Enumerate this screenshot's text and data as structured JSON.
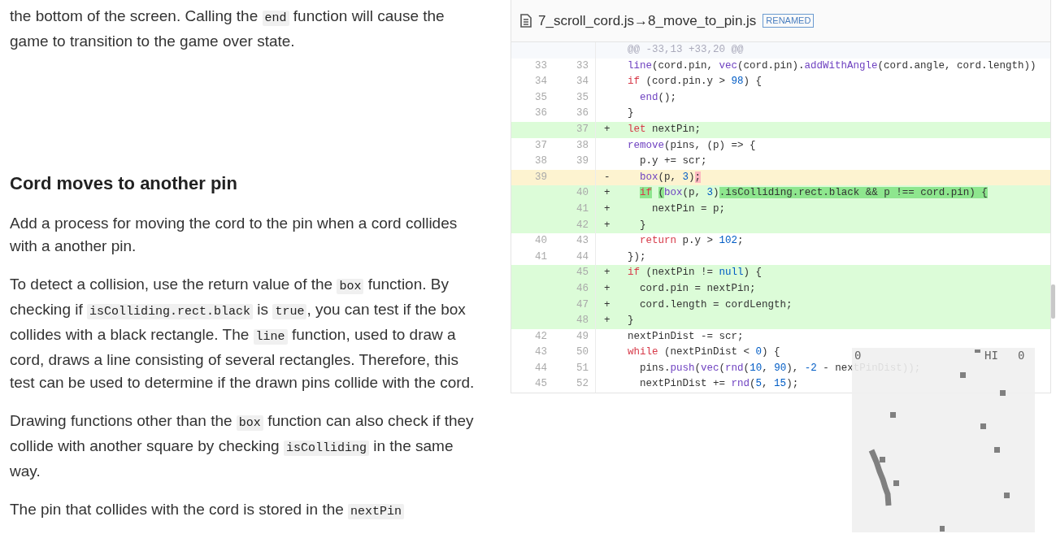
{
  "article": [
    {
      "kind": "paragraph",
      "parts": [
        {
          "kind": "text",
          "text": "the bottom of the screen. Calling the "
        },
        {
          "kind": "code",
          "text": "end"
        },
        {
          "kind": "text",
          "text": " function will cause the game to transition to the game over state."
        }
      ]
    },
    {
      "kind": "heading",
      "parts": [
        {
          "kind": "text",
          "text": "Cord moves to another pin"
        }
      ]
    },
    {
      "kind": "paragraph",
      "parts": [
        {
          "kind": "text",
          "text": "Add a process for moving the cord to the pin when a cord collides with a another pin."
        }
      ]
    },
    {
      "kind": "paragraph",
      "parts": [
        {
          "kind": "text",
          "text": "To detect a collision, use the return value of the "
        },
        {
          "kind": "code",
          "text": "box"
        },
        {
          "kind": "text",
          "text": " function. By checking if "
        },
        {
          "kind": "code",
          "text": "isColliding.rect.black"
        },
        {
          "kind": "text",
          "text": " is "
        },
        {
          "kind": "code",
          "text": "true"
        },
        {
          "kind": "text",
          "text": ", you can test if the box collides with a black rectangle. The "
        },
        {
          "kind": "code",
          "text": "line"
        },
        {
          "kind": "text",
          "text": " function, used to draw a cord, draws a line consisting of several rectangles. Therefore, this test can be used to determine if the drawn pins collide with the cord."
        }
      ]
    },
    {
      "kind": "paragraph",
      "parts": [
        {
          "kind": "text",
          "text": "Drawing functions other than the "
        },
        {
          "kind": "code",
          "text": "box"
        },
        {
          "kind": "text",
          "text": " function can also check if they collide with another square by checking "
        },
        {
          "kind": "code",
          "text": "isColliding"
        },
        {
          "kind": "text",
          "text": " in the same way."
        }
      ]
    },
    {
      "kind": "paragraph",
      "parts": [
        {
          "kind": "text",
          "text": "The pin that collides with the cord is stored in the "
        },
        {
          "kind": "code",
          "text": "nextPin"
        }
      ]
    }
  ],
  "diff": {
    "old_file": "7_scroll_cord.js",
    "arrow": "→",
    "new_file": "8_move_to_pin.js",
    "badge": "RENAMED",
    "lines": [
      {
        "kind": "hunk",
        "code": [
          {
            "t": "@@ -33,13 +33,20 @@",
            "kind": "plain"
          }
        ]
      },
      {
        "kind": "context",
        "old": "33",
        "new": "33",
        "code": [
          {
            "t": "line",
            "kind": "fn"
          },
          {
            "t": "(cord.pin, ",
            "kind": "plain"
          },
          {
            "t": "vec",
            "kind": "fn"
          },
          {
            "t": "(cord.pin).",
            "kind": "plain"
          },
          {
            "t": "addWithAngle",
            "kind": "fn"
          },
          {
            "t": "(cord.angle, cord.length))",
            "kind": "plain"
          }
        ]
      },
      {
        "kind": "context",
        "old": "34",
        "new": "34",
        "code": [
          {
            "t": "if",
            "kind": "kw"
          },
          {
            "t": " (cord.pin.y > ",
            "kind": "plain"
          },
          {
            "t": "98",
            "kind": "num"
          },
          {
            "t": ") {",
            "kind": "plain"
          }
        ]
      },
      {
        "kind": "context",
        "old": "35",
        "new": "35",
        "code": [
          {
            "t": "  end",
            "kind": "fn"
          },
          {
            "t": "();",
            "kind": "plain"
          }
        ]
      },
      {
        "kind": "context",
        "old": "36",
        "new": "36",
        "code": [
          {
            "t": "}",
            "kind": "plain"
          }
        ]
      },
      {
        "kind": "add",
        "new": "37",
        "sign": "+",
        "code": [
          {
            "t": "let",
            "kind": "kw"
          },
          {
            "t": " nextPin;",
            "kind": "plain"
          }
        ]
      },
      {
        "kind": "context",
        "old": "37",
        "new": "38",
        "code": [
          {
            "t": "remove",
            "kind": "fn"
          },
          {
            "t": "(pins, (p) => {",
            "kind": "plain"
          }
        ]
      },
      {
        "kind": "context",
        "old": "38",
        "new": "39",
        "code": [
          {
            "t": "  p.y += scr;",
            "kind": "plain"
          }
        ]
      },
      {
        "kind": "del",
        "old": "39",
        "sign": "-",
        "code": [
          {
            "t": "  box",
            "kind": "fn",
            "changed": false
          },
          {
            "t": "(p, ",
            "kind": "plain",
            "changed": false
          },
          {
            "t": "3",
            "kind": "num",
            "changed": false
          },
          {
            "t": ")",
            "kind": "plain",
            "changed": false
          },
          {
            "t": ";",
            "kind": "plain",
            "changed": true
          }
        ]
      },
      {
        "kind": "add",
        "new": "40",
        "sign": "+",
        "code": [
          {
            "t": "  if",
            "kind": "kw",
            "changed": true
          },
          {
            "t": " (",
            "kind": "plain",
            "changed": true
          },
          {
            "t": "box",
            "kind": "fn",
            "changed": false
          },
          {
            "t": "(p, ",
            "kind": "plain",
            "changed": false
          },
          {
            "t": "3",
            "kind": "num",
            "changed": false
          },
          {
            "t": ")",
            "kind": "plain",
            "changed": false
          },
          {
            "t": ".isColliding.rect.black && p !== cord.pin) {",
            "kind": "plain",
            "changed": true
          }
        ]
      },
      {
        "kind": "add",
        "new": "41",
        "sign": "+",
        "code": [
          {
            "t": "    nextPin = p;",
            "kind": "plain"
          }
        ]
      },
      {
        "kind": "add",
        "new": "42",
        "sign": "+",
        "code": [
          {
            "t": "  }",
            "kind": "plain"
          }
        ]
      },
      {
        "kind": "context",
        "old": "40",
        "new": "43",
        "code": [
          {
            "t": "  return",
            "kind": "kw"
          },
          {
            "t": " p.y > ",
            "kind": "plain"
          },
          {
            "t": "102",
            "kind": "num"
          },
          {
            "t": ";",
            "kind": "plain"
          }
        ]
      },
      {
        "kind": "context",
        "old": "41",
        "new": "44",
        "code": [
          {
            "t": "});",
            "kind": "plain"
          }
        ]
      },
      {
        "kind": "add",
        "new": "45",
        "sign": "+",
        "code": [
          {
            "t": "if",
            "kind": "kw"
          },
          {
            "t": " (nextPin != ",
            "kind": "plain"
          },
          {
            "t": "null",
            "kind": "num"
          },
          {
            "t": ") {",
            "kind": "plain"
          }
        ]
      },
      {
        "kind": "add",
        "new": "46",
        "sign": "+",
        "code": [
          {
            "t": "  cord.pin = nextPin;",
            "kind": "plain"
          }
        ]
      },
      {
        "kind": "add",
        "new": "47",
        "sign": "+",
        "code": [
          {
            "t": "  cord.length = cordLength;",
            "kind": "plain"
          }
        ]
      },
      {
        "kind": "add",
        "new": "48",
        "sign": "+",
        "code": [
          {
            "t": "}",
            "kind": "plain"
          }
        ]
      },
      {
        "kind": "context",
        "old": "42",
        "new": "49",
        "code": [
          {
            "t": "nextPinDist -= scr;",
            "kind": "plain"
          }
        ]
      },
      {
        "kind": "context",
        "old": "43",
        "new": "50",
        "code": [
          {
            "t": "while",
            "kind": "kw"
          },
          {
            "t": " (nextPinDist < ",
            "kind": "plain"
          },
          {
            "t": "0",
            "kind": "num"
          },
          {
            "t": ") {",
            "kind": "plain"
          }
        ]
      },
      {
        "kind": "context",
        "old": "44",
        "new": "51",
        "code": [
          {
            "t": "  pins.",
            "kind": "plain"
          },
          {
            "t": "push",
            "kind": "fn"
          },
          {
            "t": "(",
            "kind": "plain"
          },
          {
            "t": "vec",
            "kind": "fn"
          },
          {
            "t": "(",
            "kind": "plain"
          },
          {
            "t": "rnd",
            "kind": "fn"
          },
          {
            "t": "(",
            "kind": "plain"
          },
          {
            "t": "10",
            "kind": "num"
          },
          {
            "t": ", ",
            "kind": "plain"
          },
          {
            "t": "90",
            "kind": "num"
          },
          {
            "t": "), ",
            "kind": "plain"
          },
          {
            "t": "-2",
            "kind": "num"
          },
          {
            "t": " - nextPinDist));",
            "kind": "plain"
          }
        ]
      },
      {
        "kind": "context",
        "old": "45",
        "new": "52",
        "code": [
          {
            "t": "  nextPinDist += ",
            "kind": "plain"
          },
          {
            "t": "rnd",
            "kind": "fn"
          },
          {
            "t": "(",
            "kind": "plain"
          },
          {
            "t": "5",
            "kind": "num"
          },
          {
            "t": ", ",
            "kind": "plain"
          },
          {
            "t": "15",
            "kind": "num"
          },
          {
            "t": ");",
            "kind": "plain"
          }
        ]
      }
    ]
  },
  "game": {
    "score": "0",
    "hi_label": "HI",
    "hi_score": "0"
  }
}
